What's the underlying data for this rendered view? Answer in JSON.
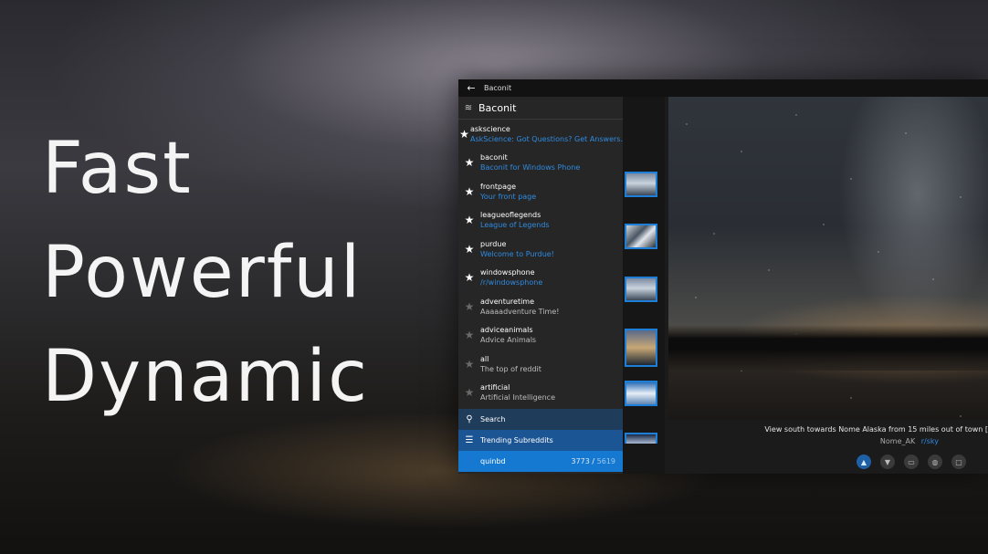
{
  "hero": {
    "line1": "Fast",
    "line2": "Powerful",
    "line3": "Dynamic"
  },
  "window": {
    "title": "Baconit",
    "back_icon": "back-arrow-icon"
  },
  "sidebar": {
    "header": {
      "label": "Baconit",
      "icon": "lines-icon"
    },
    "items": [
      {
        "name": "askscience",
        "desc": "AskScience: Got Questions? Get Answers.",
        "favorite": true
      },
      {
        "name": "baconit",
        "desc": "Baconit for Windows Phone",
        "favorite": true
      },
      {
        "name": "frontpage",
        "desc": "Your front page",
        "favorite": true
      },
      {
        "name": "leagueoflegends",
        "desc": "League of Legends",
        "favorite": true
      },
      {
        "name": "purdue",
        "desc": "Welcome to Purdue!",
        "favorite": true
      },
      {
        "name": "windowsphone",
        "desc": "/r/windowsphone",
        "favorite": true
      },
      {
        "name": "adventuretime",
        "desc": "Aaaaadventure Time!",
        "favorite": false
      },
      {
        "name": "adviceanimals",
        "desc": "Advice Animals",
        "favorite": false
      },
      {
        "name": "all",
        "desc": "The top of reddit",
        "favorite": false
      },
      {
        "name": "artificial",
        "desc": "Artificial Intelligence",
        "favorite": false
      }
    ],
    "search_label": "Search",
    "trending_label": "Trending Subreddits",
    "user": {
      "name": "quinbd",
      "karma_link": "3773",
      "separator": "/",
      "karma_comment": "5619"
    }
  },
  "post": {
    "caption": "View south towards Nome Alaska from 15 miles out of town [",
    "author": "Nome_AK",
    "subreddit": "r/sky"
  },
  "colors": {
    "accent": "#1679d1",
    "link": "#2f8be0"
  }
}
